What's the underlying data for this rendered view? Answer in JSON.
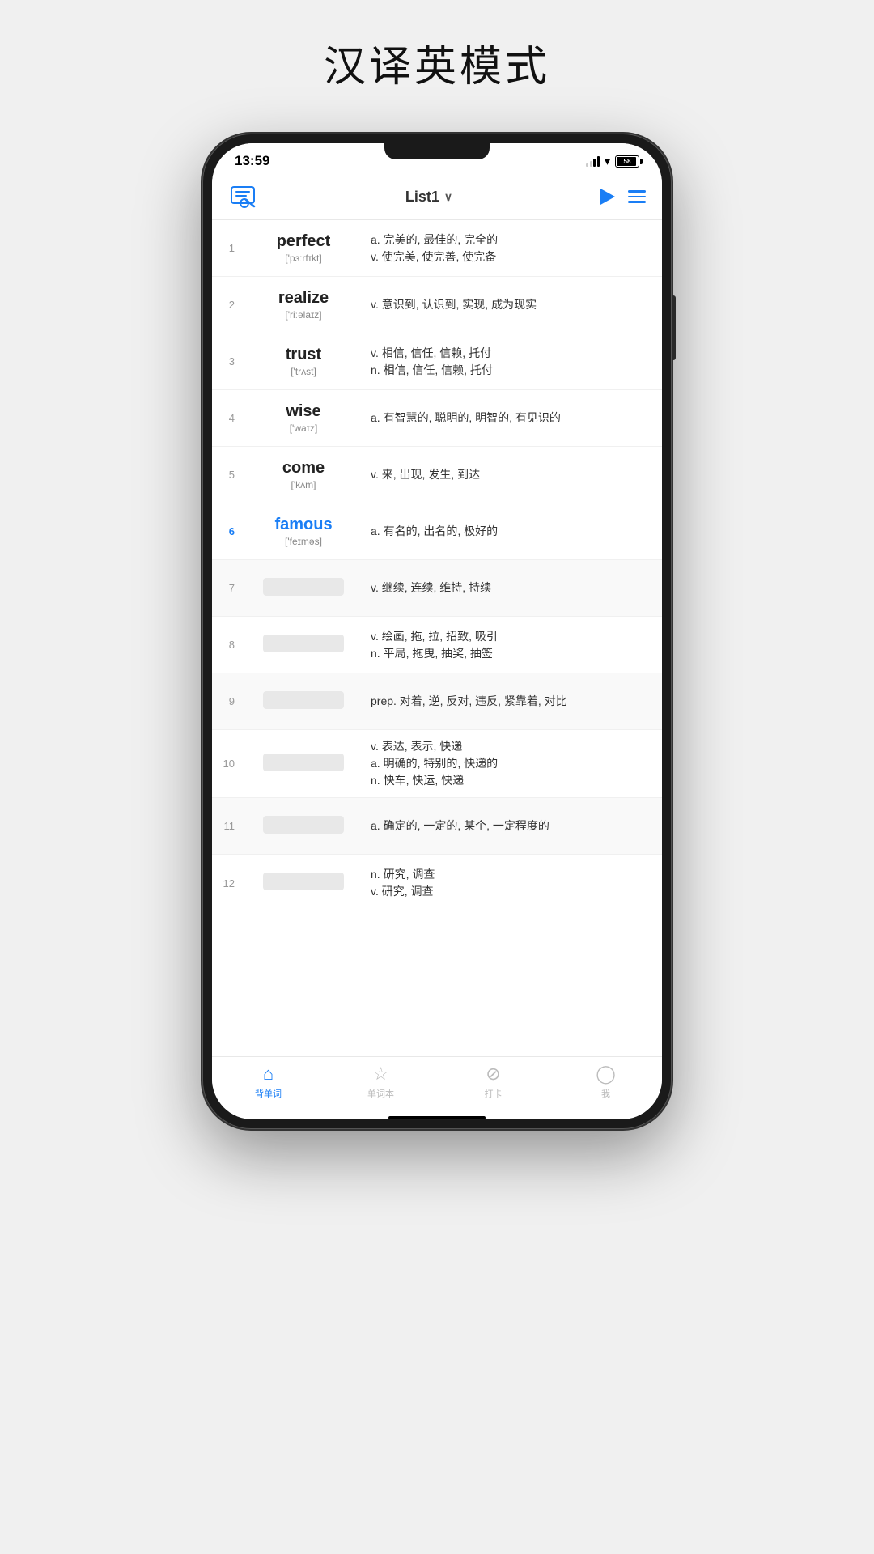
{
  "page": {
    "title": "汉译英模式"
  },
  "status_bar": {
    "time": "13:59",
    "battery": "58"
  },
  "nav": {
    "list_name": "List1",
    "logo_label": "app-logo"
  },
  "words": [
    {
      "num": "1",
      "word": "perfect",
      "phonetic": "['pɜːrfɪkt]",
      "meaning": "a. 完美的, 最佳的, 完全的\nv. 使完美, 使完善, 使完备",
      "active": false,
      "hidden": false
    },
    {
      "num": "2",
      "word": "realize",
      "phonetic": "['riːəlaɪz]",
      "meaning": "v. 意识到, 认识到, 实现, 成为现实",
      "active": false,
      "hidden": false
    },
    {
      "num": "3",
      "word": "trust",
      "phonetic": "['trʌst]",
      "meaning": "v. 相信, 信任, 信赖, 托付\nn. 相信, 信任, 信赖, 托付",
      "active": false,
      "hidden": false
    },
    {
      "num": "4",
      "word": "wise",
      "phonetic": "['waɪz]",
      "meaning": "a. 有智慧的, 聪明的, 明智的, 有见识的",
      "active": false,
      "hidden": false
    },
    {
      "num": "5",
      "word": "come",
      "phonetic": "['kʌm]",
      "meaning": "v. 来, 出现, 发生, 到达",
      "active": false,
      "hidden": false
    },
    {
      "num": "6",
      "word": "famous",
      "phonetic": "['feɪməs]",
      "meaning": "a. 有名的, 出名的, 极好的",
      "active": true,
      "hidden": false
    },
    {
      "num": "7",
      "word": "",
      "phonetic": "",
      "meaning": "v. 继续, 连续, 维持, 持续",
      "active": false,
      "hidden": true
    },
    {
      "num": "8",
      "word": "",
      "phonetic": "",
      "meaning": "v. 绘画, 拖, 拉, 招致, 吸引\nn. 平局, 拖曳, 抽奖, 抽签",
      "active": false,
      "hidden": true
    },
    {
      "num": "9",
      "word": "",
      "phonetic": "",
      "meaning": "prep. 对着, 逆, 反对, 违反, 紧靠着, 对比",
      "active": false,
      "hidden": true
    },
    {
      "num": "10",
      "word": "",
      "phonetic": "",
      "meaning": "v. 表达, 表示, 快递\na. 明确的, 特别的, 快递的\nn. 快车, 快运, 快递",
      "active": false,
      "hidden": true
    },
    {
      "num": "11",
      "word": "",
      "phonetic": "",
      "meaning": "a. 确定的, 一定的, 某个, 一定程度的",
      "active": false,
      "hidden": true
    },
    {
      "num": "12",
      "word": "",
      "phonetic": "",
      "meaning": "n. 研究, 调查\nv. 研究, 调查",
      "active": false,
      "hidden": true
    }
  ],
  "bottom_nav": {
    "items": [
      {
        "label": "背单词",
        "active": true
      },
      {
        "label": "单词本",
        "active": false
      },
      {
        "label": "打卡",
        "active": false
      },
      {
        "label": "我",
        "active": false
      }
    ]
  }
}
